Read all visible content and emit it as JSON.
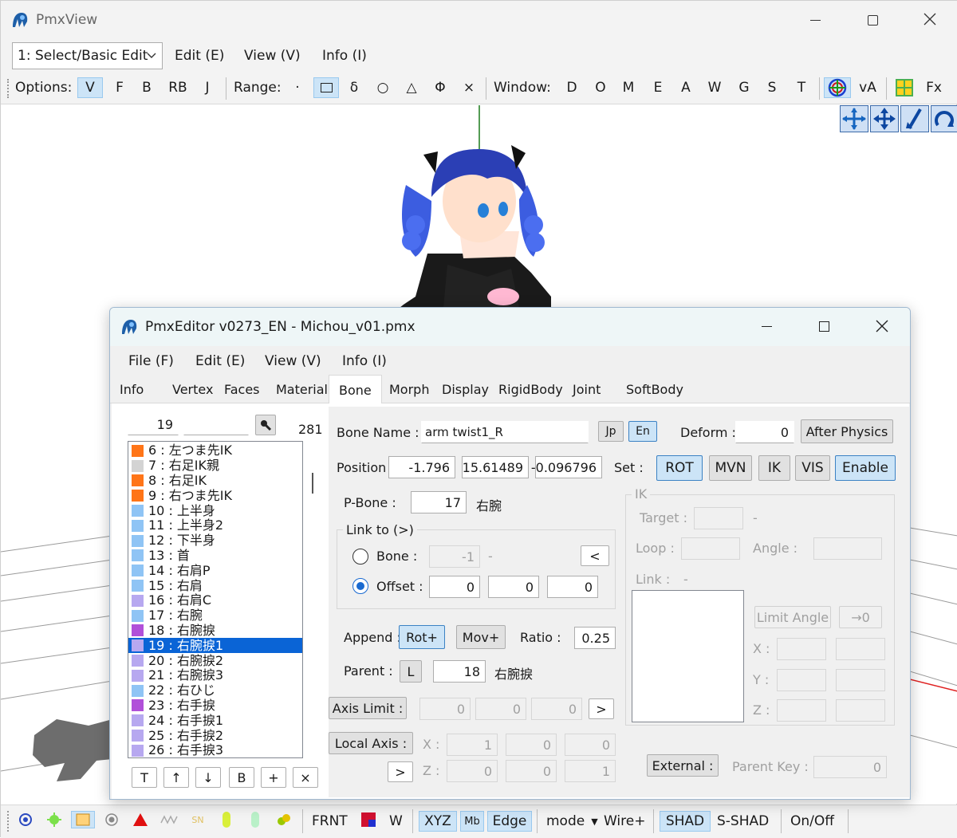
{
  "viewer": {
    "title": "PmxView",
    "mode_select": "1: Select/Basic Edit",
    "menu": [
      "Edit (E)",
      "View (V)",
      "Info (I)"
    ],
    "options_label": "Options:",
    "options": [
      "V",
      "F",
      "B",
      "RB",
      "J"
    ],
    "range_label": "Range:",
    "range_items": [
      "·",
      "δ",
      "○",
      "△",
      "Φ",
      "×"
    ],
    "window_label": "Window:",
    "window_items": [
      "D",
      "O",
      "M",
      "E",
      "A",
      "W",
      "G",
      "S",
      "T"
    ],
    "va_label": "vA",
    "fx_label": "Fx",
    "bottom": {
      "frnt": "FRNT",
      "w": "W",
      "xyz": "XYZ",
      "mb": "Mb",
      "edge": "Edge",
      "mode": "mode",
      "wire": "Wire+",
      "shad": "SHAD",
      "sshad": "S-SHAD",
      "onoff": "On/Off"
    }
  },
  "editor": {
    "title": "PmxEditor v0273_EN - Michou_v01.pmx",
    "menu": [
      "File (F)",
      "Edit (E)",
      "View (V)",
      "Info (I)"
    ],
    "tabs": [
      "Info",
      "Vertex",
      "Faces",
      "Material",
      "Bone",
      "Morph",
      "Display",
      "RigidBody",
      "Joint",
      "SoftBody"
    ],
    "active_tab": "Bone",
    "list": {
      "index_value": "19",
      "search_value": "",
      "count": "281",
      "items": [
        {
          "text": "6 : 左つま先IK",
          "color": "#ff7518"
        },
        {
          "text": "7 : 右足IK親",
          "color": "#d3d3d3"
        },
        {
          "text": "8 : 右足IK",
          "color": "#ff7518"
        },
        {
          "text": "9 : 右つま先IK",
          "color": "#ff7518"
        },
        {
          "text": "10 : 上半身",
          "color": "#8fc4f5"
        },
        {
          "text": "11 : 上半身2",
          "color": "#8fc4f5"
        },
        {
          "text": "12 : 下半身",
          "color": "#8fc4f5"
        },
        {
          "text": "13 : 首",
          "color": "#8fc4f5"
        },
        {
          "text": "14 : 右肩P",
          "color": "#8fc4f5"
        },
        {
          "text": "15 : 右肩",
          "color": "#8fc4f5"
        },
        {
          "text": "16 : 右肩C",
          "color": "#b7a8f0"
        },
        {
          "text": "17 : 右腕",
          "color": "#8fc4f5"
        },
        {
          "text": "18 : 右腕捩",
          "color": "#b150d9"
        },
        {
          "text": "19 : 右腕捩1",
          "color": "#b7a8f0",
          "selected": true
        },
        {
          "text": "20 : 右腕捩2",
          "color": "#b7a8f0"
        },
        {
          "text": "21 : 右腕捩3",
          "color": "#b7a8f0"
        },
        {
          "text": "22 : 右ひじ",
          "color": "#8fc4f5"
        },
        {
          "text": "23 : 右手捩",
          "color": "#b150d9"
        },
        {
          "text": "24 : 右手捩1",
          "color": "#b7a8f0"
        },
        {
          "text": "25 : 右手捩2",
          "color": "#b7a8f0"
        },
        {
          "text": "26 : 右手捩3",
          "color": "#b7a8f0"
        }
      ],
      "buttons": [
        "T",
        "↑",
        "↓",
        "B",
        "+",
        "×"
      ]
    },
    "bone": {
      "name_label": "Bone Name :",
      "name_value": "arm twist1_R",
      "jp": "Jp",
      "en": "En",
      "deform_label": "Deform :",
      "deform_value": "0",
      "after_physics": "After Physics",
      "position_label": "Position",
      "pos_x": "-1.796",
      "pos_y": "15.61489",
      "pos_z": "-0.096796",
      "set_label": "Set :",
      "set_buttons": [
        "ROT",
        "MVN",
        "IK",
        "VIS",
        "Enable"
      ],
      "pbone_label": "P-Bone :",
      "pbone_value": "17",
      "pbone_name": "右腕",
      "linkto_label": "Link to (>)",
      "bone_radio": "Bone :",
      "bone_link_value": "-1",
      "bone_link_dash": "-",
      "lt_btn": "<",
      "offset_radio": "Offset :",
      "offset_x": "0",
      "offset_y": "0",
      "offset_z": "0",
      "append_label": "Append :",
      "rot_plus": "Rot+",
      "mov_plus": "Mov+",
      "ratio_label": "Ratio :",
      "ratio_value": "0.25",
      "parent_label": "Parent :",
      "l_btn": "L",
      "parent_value": "18",
      "parent_name": "右腕捩",
      "axis_limit": "Axis Limit :",
      "axis_x": "0",
      "axis_y": "0",
      "axis_z": "0",
      "gt_btn": ">",
      "local_axis": "Local Axis :",
      "x_label": "X :",
      "z_label": "Z :",
      "lx1": "1",
      "lx2": "0",
      "lx3": "0",
      "lz1": "0",
      "lz2": "0",
      "lz3": "1",
      "gt_btn2": ">"
    },
    "ik": {
      "title": "IK",
      "target_label": "Target :",
      "target_dash": "-",
      "loop_label": "Loop :",
      "angle_label": "Angle :",
      "link_label": "Link :",
      "link_dash": "-",
      "limit_angle": "Limit Angle",
      "to_zero": "→0",
      "x": "X :",
      "y": "Y :",
      "z": "Z :",
      "external": "External :",
      "parent_key_label": "Parent Key :",
      "parent_key_value": "0"
    }
  }
}
